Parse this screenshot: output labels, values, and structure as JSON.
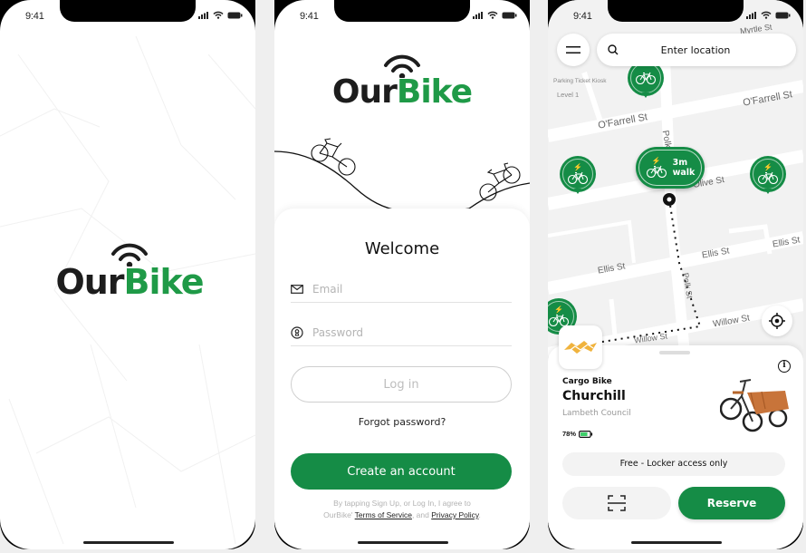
{
  "status_bar": {
    "time": "9:41"
  },
  "brand": {
    "name_part1": "Our",
    "name_part2": "Bike",
    "green": "#1f9a47",
    "button_green": "#158c46",
    "dark": "#1d1d1d"
  },
  "screens": {
    "splash": {
      "icon": "wifi-logo-icon"
    },
    "login": {
      "welcome": "Welcome",
      "email_placeholder": "Email",
      "password_placeholder": "Password",
      "login_label": "Log in",
      "forgot_label": "Forgot password?",
      "create_label": "Create an account",
      "terms_prefix": "By tapping Sign Up, or Log In, I agree to OurBike'",
      "terms_link": "Terms of Service",
      "terms_mid": ", and",
      "privacy_link": "Privacy Policy",
      "terms_suffix": "."
    },
    "map": {
      "search_placeholder": "Enter location",
      "streets": {
        "myrtle": "Myrtle St",
        "ofarrell_1": "O'Farrell St",
        "ofarrell_2": "O'Farrell St",
        "polk_1": "Polk",
        "polk_2": "Polk St",
        "olive": "Olive St",
        "ellis_1": "Ellis St",
        "ellis_2": "Ellis St",
        "ellis_3": "Ellis St",
        "willow_1": "Willow St",
        "willow_2": "Willow St"
      },
      "poi": {
        "name": "Parking Ticket Kiosk",
        "level": "Level 1"
      },
      "walk_pin": {
        "line1": "3m",
        "line2": "walk"
      },
      "bike": {
        "type": "Cargo Bike",
        "name": "Churchill",
        "owner": "Lambeth Council",
        "battery": "78%",
        "battery_level": 0.78,
        "price": "Free - Locker access only"
      },
      "reserve_label": "Reserve"
    }
  }
}
